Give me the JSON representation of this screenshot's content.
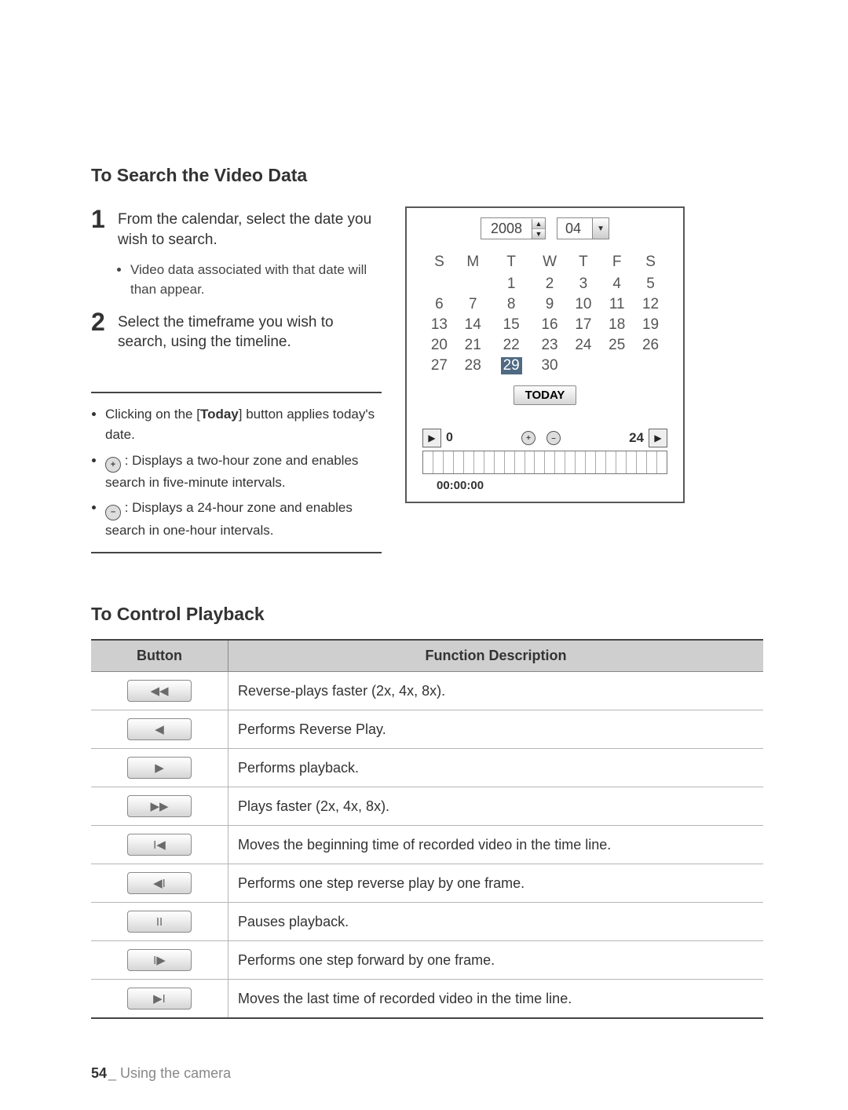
{
  "section1": {
    "title": "To Search the Video Data",
    "step1_text": "From the calendar, select the date you wish to search.",
    "step1_sub": "Video data associated with that date will than appear.",
    "step2_text": "Select the timeframe you wish to search, using the timeline.",
    "note_today_pre": "Clicking on the [",
    "note_today_bold": "Today",
    "note_today_post": "] button applies today's date.",
    "note_plus": ": Displays a two-hour zone and enables search in five-minute intervals.",
    "note_minus": ": Displays a 24-hour zone and enables search in one-hour intervals."
  },
  "calendar": {
    "year": "2008",
    "month": "04",
    "dow": [
      "S",
      "M",
      "T",
      "W",
      "T",
      "F",
      "S"
    ],
    "weeks": [
      [
        "",
        "",
        "1",
        "2",
        "3",
        "4",
        "5"
      ],
      [
        "6",
        "7",
        "8",
        "9",
        "10",
        "11",
        "12"
      ],
      [
        "13",
        "14",
        "15",
        "16",
        "17",
        "18",
        "19"
      ],
      [
        "20",
        "21",
        "22",
        "23",
        "24",
        "25",
        "26"
      ],
      [
        "27",
        "28",
        "29",
        "30",
        "",
        "",
        ""
      ]
    ],
    "selected": "29",
    "today_label": "TODAY",
    "timeline_start": "0",
    "timeline_end": "24",
    "time_label": "00:00:00"
  },
  "section2": {
    "title": "To Control Playback",
    "head_button": "Button",
    "head_desc": "Function Description",
    "rows": [
      {
        "icon": "◀◀",
        "desc": "Reverse-plays faster (2x, 4x, 8x)."
      },
      {
        "icon": "◀",
        "desc": "Performs Reverse Play."
      },
      {
        "icon": "▶",
        "desc": "Performs playback."
      },
      {
        "icon": "▶▶",
        "desc": "Plays faster (2x, 4x, 8x)."
      },
      {
        "icon": "I◀",
        "desc": "Moves the beginning time of recorded video in the time line."
      },
      {
        "icon": "◀I",
        "desc": "Performs one step reverse play by one frame."
      },
      {
        "icon": "II",
        "desc": "Pauses playback."
      },
      {
        "icon": "I▶",
        "desc": "Performs one step forward by one frame."
      },
      {
        "icon": "▶I",
        "desc": "Moves the last time of recorded video in the time line."
      }
    ]
  },
  "footer": {
    "page": "54",
    "chapter": "Using the camera"
  }
}
